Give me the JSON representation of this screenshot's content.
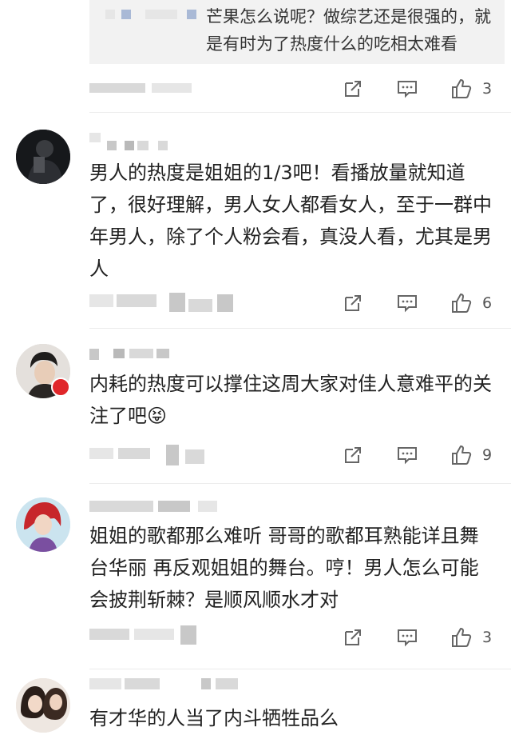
{
  "reply": {
    "text": "芒果怎么说呢？做综艺还是很强的，就是有时为了热度什么的吃相太难看",
    "like_count": "3"
  },
  "comments": [
    {
      "text": "男人的热度是姐姐的1/3吧！看播放量就知道了，很好理解，男人女人都看女人，至于一群中年男人，除了个人粉会看，真没人看，尤其是男人",
      "like_count": "6",
      "avatar_icon": "user-avatar-icon",
      "has_badge": false
    },
    {
      "text": "内耗的热度可以撑住这周大家对佳人意难平的关注了吧",
      "emoji": "😝",
      "like_count": "9",
      "avatar_icon": "user-avatar-icon",
      "has_badge": true
    },
    {
      "text": "姐姐的歌都那么难听 哥哥的歌都耳熟能详且舞台华丽 再反观姐姐的舞台。哼！男人怎么可能会披荆斩棘？是顺风顺水才对",
      "like_count": "3",
      "avatar_icon": "user-avatar-icon",
      "has_badge": false
    },
    {
      "text": "有才华的人当了内斗牺牲品么",
      "like_count": "",
      "avatar_icon": "user-avatar-icon",
      "has_badge": false
    }
  ],
  "icons": {
    "share": "share-icon",
    "comment": "comment-icon",
    "like": "thumbs-up-icon"
  },
  "colors": {
    "background": "#ffffff",
    "reply_background": "#f2f2f2",
    "text": "#222222",
    "icon": "#666666",
    "badge": "#e0262a"
  }
}
